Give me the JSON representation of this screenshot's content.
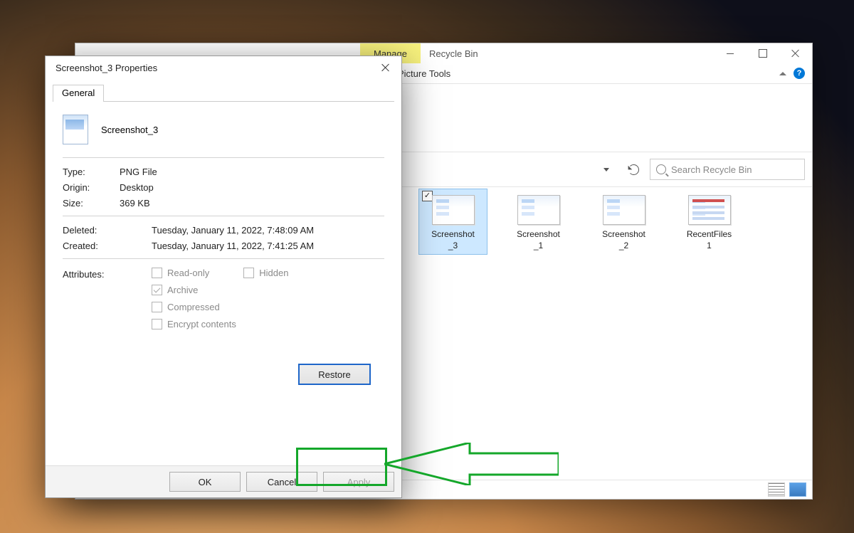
{
  "explorer": {
    "title": "Recycle Bin",
    "ribbon": {
      "context_group": "Manage",
      "context_tab": "Picture Tools"
    },
    "address": {
      "search_placeholder": "Search Recycle Bin"
    },
    "files": [
      {
        "label": "Screenshot_3",
        "selected": true,
        "checked": true,
        "accent": false
      },
      {
        "label": "Screenshot_1",
        "selected": false,
        "checked": false,
        "accent": false
      },
      {
        "label": "Screenshot_2",
        "selected": false,
        "checked": false,
        "accent": false
      },
      {
        "label": "RecentFiles1",
        "selected": false,
        "checked": false,
        "accent": true
      }
    ]
  },
  "properties": {
    "title": "Screenshot_3 Properties",
    "tab": "General",
    "filename": "Screenshot_3",
    "type_label": "Type:",
    "type_value": "PNG File",
    "origin_label": "Origin:",
    "origin_value": "Desktop",
    "size_label": "Size:",
    "size_value": "369 KB",
    "deleted_label": "Deleted:",
    "deleted_value": "Tuesday, January 11, 2022, 7:48:09 AM",
    "created_label": "Created:",
    "created_value": "Tuesday, January 11, 2022, 7:41:25 AM",
    "attributes_label": "Attributes:",
    "attr_readonly": "Read-only",
    "attr_hidden": "Hidden",
    "attr_archive": "Archive",
    "attr_compressed": "Compressed",
    "attr_encrypt": "Encrypt contents",
    "archive_checked": true,
    "restore_label": "Restore",
    "ok_label": "OK",
    "cancel_label": "Cancel",
    "apply_label": "Apply"
  }
}
